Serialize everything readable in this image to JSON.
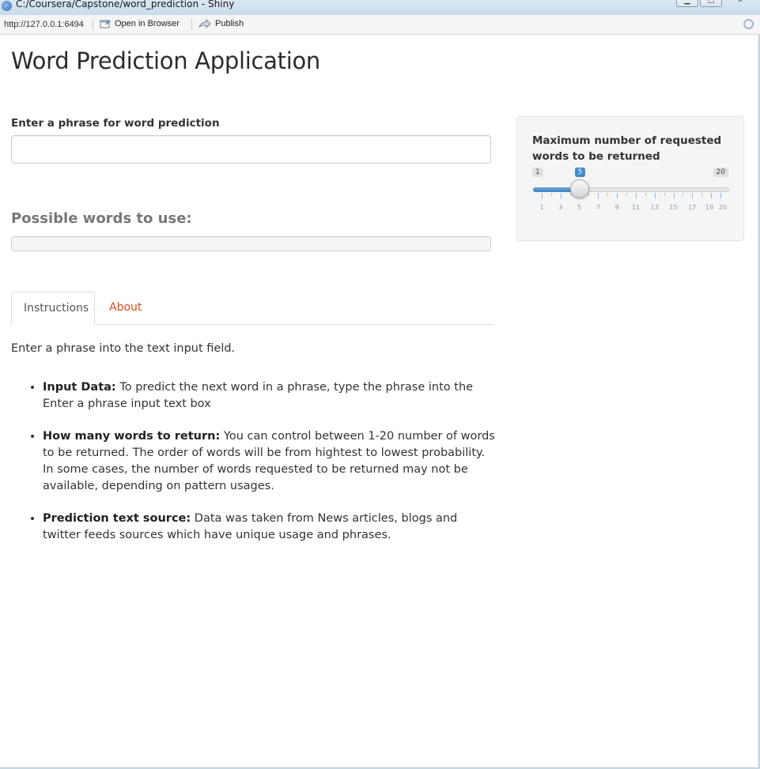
{
  "window": {
    "title": "C:/Coursera/Capstone/word_prediction - Shiny"
  },
  "toolbar": {
    "url": "http://127.0.0.1:6494",
    "open_in_browser": "Open in Browser",
    "publish": "Publish"
  },
  "app": {
    "title": "Word Prediction Application",
    "input_label": "Enter a phrase for word prediction",
    "input_value": "",
    "possible_heading": "Possible words to use:",
    "output_value": ""
  },
  "tabs": [
    {
      "label": "Instructions",
      "active": true
    },
    {
      "label": "About",
      "active": false
    }
  ],
  "instructions": {
    "intro": "Enter a phrase into the text input field.",
    "items": [
      {
        "title": "Input Data:",
        "text": " To predict the next word in a phrase, type the phrase into the Enter a phrase input text box"
      },
      {
        "title": "How many words to return:",
        "text": " You can control between 1-20 number of words to be returned. The order of words will be from hightest to lowest probability. In some cases, the number of words requested to be returned may not be available, depending on pattern usages."
      },
      {
        "title": "Prediction text source:",
        "text": " Data was taken from News articles, blogs and twitter feeds sources which have unique usage and phrases."
      }
    ]
  },
  "slider": {
    "label": "Maximum number of requested words to be returned",
    "min": 1,
    "max": 20,
    "value": 5,
    "min_label": "1",
    "max_label": "20",
    "value_label": "5",
    "tick_labels": [
      "1",
      "3",
      "5",
      "7",
      "9",
      "11",
      "13",
      "15",
      "17",
      "19",
      "20"
    ],
    "accent_color": "#428bca"
  },
  "colors": {
    "link": "#dd4814",
    "muted_heading": "#777777"
  },
  "icons": {
    "open_in_browser": "browser-window-icon",
    "publish": "publish-arrow-icon",
    "refresh": "refresh-icon"
  }
}
